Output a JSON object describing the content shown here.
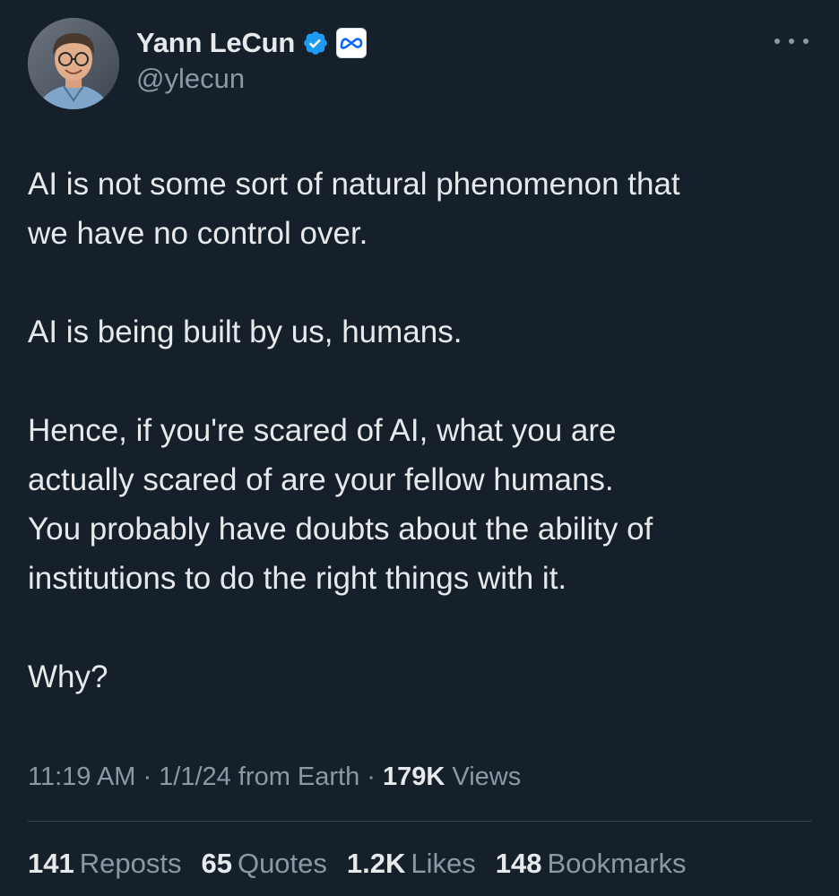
{
  "author": {
    "display_name": "Yann LeCun",
    "handle": "@ylecun",
    "verified_icon": "verified-badge-icon",
    "affiliation_icon": "meta-logo-icon"
  },
  "tweet": {
    "lines": [
      "AI is not some sort of natural phenomenon that",
      "we have no control over.",
      "",
      "AI is being built by us, humans.",
      "",
      "Hence, if you're scared of AI, what you are",
      "actually scared of are your fellow humans.",
      "You probably have doubts about the ability of",
      "institutions to do the right things with it.",
      "",
      "Why?"
    ]
  },
  "meta": {
    "time": "11:19 AM",
    "sep1": " · ",
    "date": "1/1/24",
    "source": " from Earth",
    "sep2": " · ",
    "views_count": "179K",
    "views_label": " Views"
  },
  "stats": [
    {
      "count": "141",
      "label": "Reposts"
    },
    {
      "count": "65",
      "label": "Quotes"
    },
    {
      "count": "1.2K",
      "label": "Likes"
    },
    {
      "count": "148",
      "label": "Bookmarks"
    }
  ],
  "colors": {
    "background": "#15202b",
    "text_primary": "#e7e9ea",
    "text_secondary": "#8b98a5",
    "verified_blue": "#1d9bf0",
    "divider": "#38444d"
  }
}
